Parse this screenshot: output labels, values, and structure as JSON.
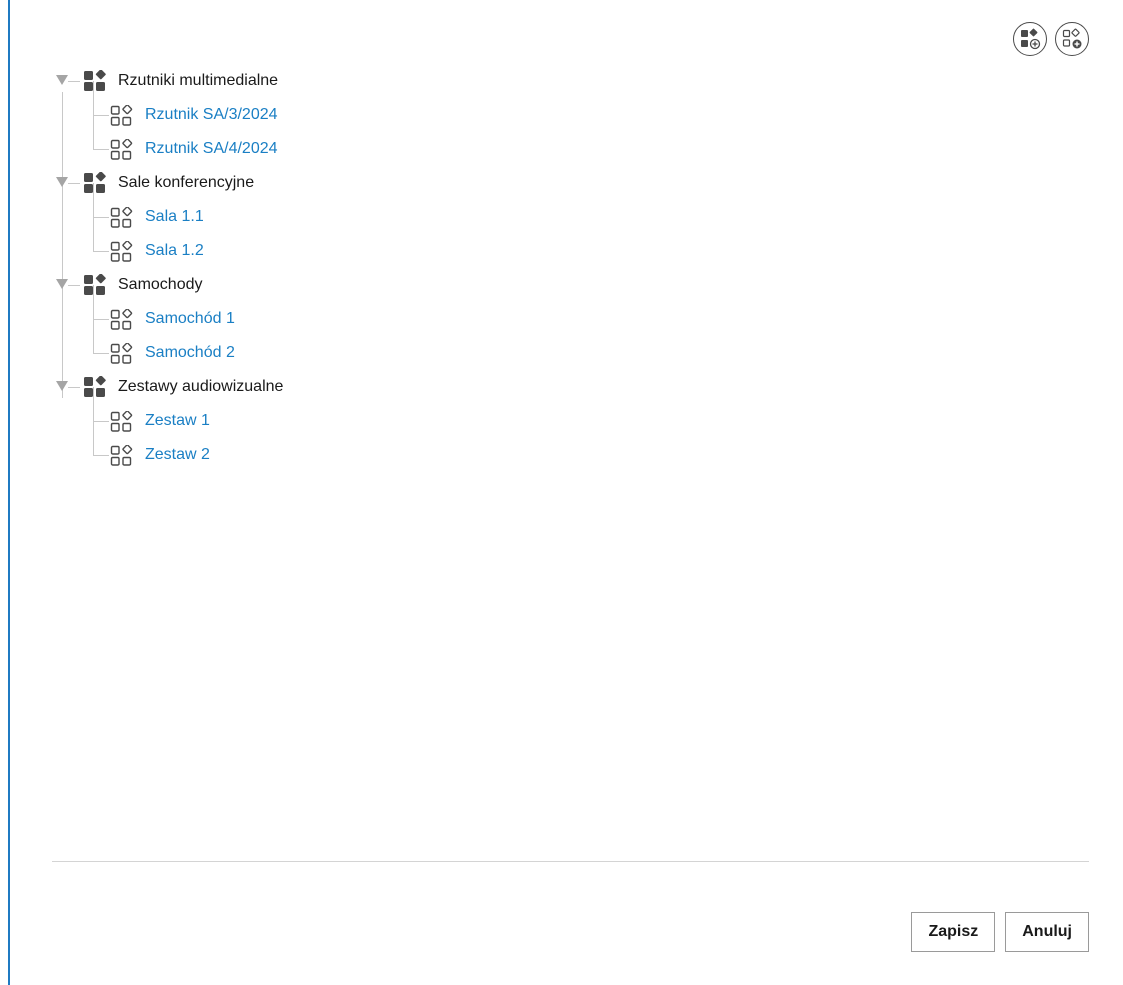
{
  "toolbar": {
    "add_category_icon": "add-category-icon",
    "add_resource_icon": "add-resource-icon"
  },
  "tree": {
    "categories": [
      {
        "label": "Rzutniki multimedialne",
        "children": [
          "Rzutnik SA/3/2024",
          "Rzutnik SA/4/2024"
        ]
      },
      {
        "label": "Sale konferencyjne",
        "children": [
          "Sala 1.1",
          "Sala 1.2"
        ]
      },
      {
        "label": "Samochody",
        "children": [
          "Samochód 1",
          "Samochód 2"
        ]
      },
      {
        "label": "Zestawy audiowizualne",
        "children": [
          "Zestaw 1",
          "Zestaw 2"
        ]
      }
    ]
  },
  "footer": {
    "save_label": "Zapisz",
    "cancel_label": "Anuluj"
  },
  "colors": {
    "accent": "#1f7ac2",
    "link": "#1a7fc4",
    "icon": "#4a4a4a",
    "toggle": "#a5a5a5"
  }
}
